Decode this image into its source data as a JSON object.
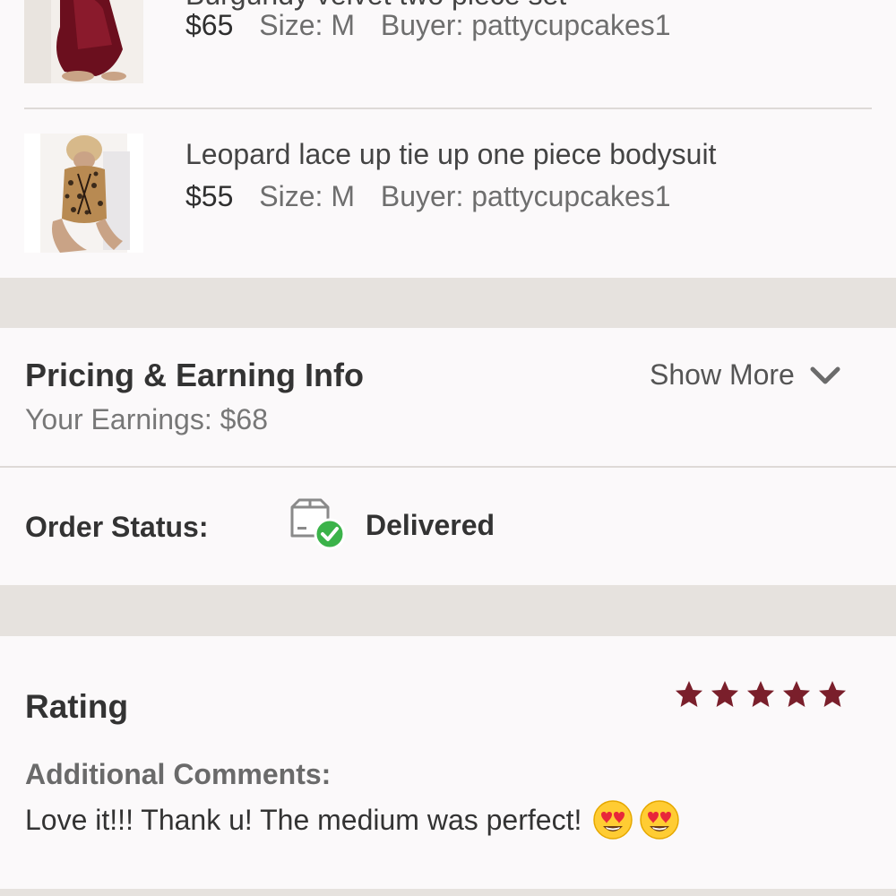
{
  "order_items": [
    {
      "title": "Burgundy velvet two piece set",
      "price": "$65",
      "size": "Size: M",
      "buyer": "Buyer: pattycupcakes1"
    },
    {
      "title": "Leopard lace up tie up one piece bodysuit",
      "price": "$55",
      "size": "Size: M",
      "buyer": "Buyer: pattycupcakes1"
    }
  ],
  "pricing": {
    "title": "Pricing & Earning Info",
    "earnings": "Your Earnings: $68",
    "show_more": "Show More"
  },
  "order_status": {
    "label": "Order Status:",
    "value": "Delivered"
  },
  "rating": {
    "title": "Rating",
    "stars": 5,
    "comments_label": "Additional Comments:",
    "comment": "Love it!!! Thank u! The medium was perfect!"
  },
  "colors": {
    "star": "#7a1f2b",
    "delivered_check": "#3bb34a",
    "panel_bg": "#fbf9fa",
    "gap_bg": "#e6e2de"
  }
}
